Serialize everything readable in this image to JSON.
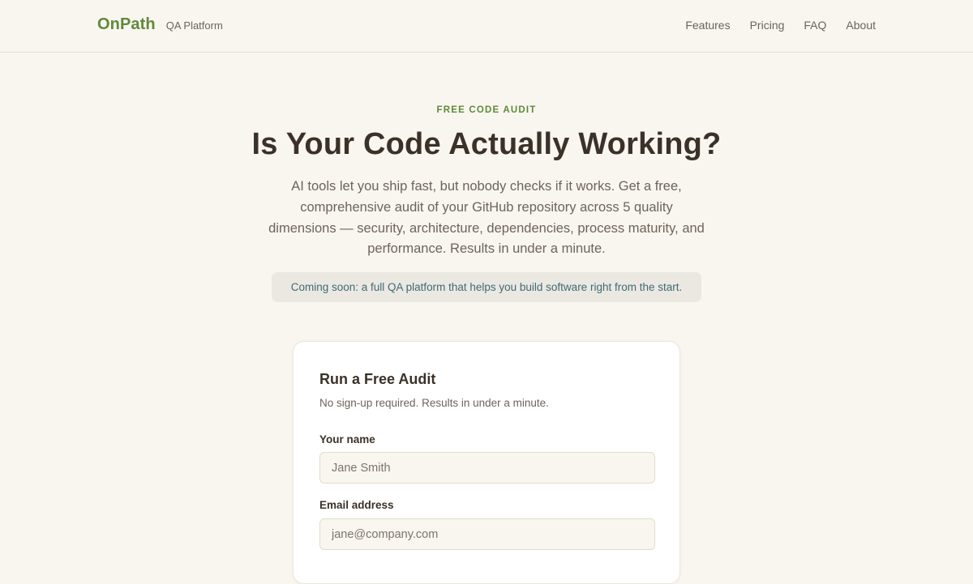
{
  "header": {
    "logo": "OnPath",
    "tagline": "QA Platform",
    "nav": [
      {
        "label": "Features"
      },
      {
        "label": "Pricing"
      },
      {
        "label": "FAQ"
      },
      {
        "label": "About"
      }
    ]
  },
  "hero": {
    "eyebrow": "FREE CODE AUDIT",
    "headline": "Is Your Code Actually Working?",
    "subtext": "AI tools let you ship fast, but nobody checks if it works. Get a free, comprehensive audit of your GitHub repository across 5 quality dimensions — security, architecture, dependencies, process maturity, and performance. Results in under a minute.",
    "notice": "Coming soon: a full QA platform that helps you build software right from the start."
  },
  "form": {
    "title": "Run a Free Audit",
    "subtitle": "No sign-up required. Results in under a minute.",
    "name_label": "Your name",
    "name_placeholder": "Jane Smith",
    "email_label": "Email address",
    "email_placeholder": "jane@company.com"
  },
  "colors": {
    "accent": "#5e8a3c",
    "background": "#f9f6ef",
    "text": "#3b3128",
    "notice_text": "#3f6a73"
  }
}
